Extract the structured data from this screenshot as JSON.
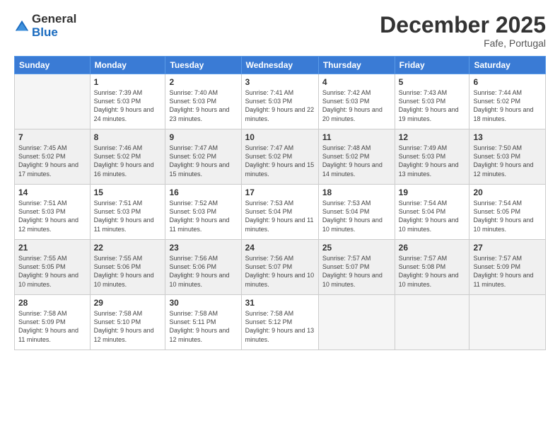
{
  "logo": {
    "general": "General",
    "blue": "Blue"
  },
  "title": "December 2025",
  "location": "Fafe, Portugal",
  "weekdays": [
    "Sunday",
    "Monday",
    "Tuesday",
    "Wednesday",
    "Thursday",
    "Friday",
    "Saturday"
  ],
  "weeks": [
    [
      {
        "day": "",
        "sunrise": "",
        "sunset": "",
        "daylight": ""
      },
      {
        "day": "1",
        "sunrise": "Sunrise: 7:39 AM",
        "sunset": "Sunset: 5:03 PM",
        "daylight": "Daylight: 9 hours and 24 minutes."
      },
      {
        "day": "2",
        "sunrise": "Sunrise: 7:40 AM",
        "sunset": "Sunset: 5:03 PM",
        "daylight": "Daylight: 9 hours and 23 minutes."
      },
      {
        "day": "3",
        "sunrise": "Sunrise: 7:41 AM",
        "sunset": "Sunset: 5:03 PM",
        "daylight": "Daylight: 9 hours and 22 minutes."
      },
      {
        "day": "4",
        "sunrise": "Sunrise: 7:42 AM",
        "sunset": "Sunset: 5:03 PM",
        "daylight": "Daylight: 9 hours and 20 minutes."
      },
      {
        "day": "5",
        "sunrise": "Sunrise: 7:43 AM",
        "sunset": "Sunset: 5:03 PM",
        "daylight": "Daylight: 9 hours and 19 minutes."
      },
      {
        "day": "6",
        "sunrise": "Sunrise: 7:44 AM",
        "sunset": "Sunset: 5:02 PM",
        "daylight": "Daylight: 9 hours and 18 minutes."
      }
    ],
    [
      {
        "day": "7",
        "sunrise": "Sunrise: 7:45 AM",
        "sunset": "Sunset: 5:02 PM",
        "daylight": "Daylight: 9 hours and 17 minutes."
      },
      {
        "day": "8",
        "sunrise": "Sunrise: 7:46 AM",
        "sunset": "Sunset: 5:02 PM",
        "daylight": "Daylight: 9 hours and 16 minutes."
      },
      {
        "day": "9",
        "sunrise": "Sunrise: 7:47 AM",
        "sunset": "Sunset: 5:02 PM",
        "daylight": "Daylight: 9 hours and 15 minutes."
      },
      {
        "day": "10",
        "sunrise": "Sunrise: 7:47 AM",
        "sunset": "Sunset: 5:02 PM",
        "daylight": "Daylight: 9 hours and 15 minutes."
      },
      {
        "day": "11",
        "sunrise": "Sunrise: 7:48 AM",
        "sunset": "Sunset: 5:02 PM",
        "daylight": "Daylight: 9 hours and 14 minutes."
      },
      {
        "day": "12",
        "sunrise": "Sunrise: 7:49 AM",
        "sunset": "Sunset: 5:03 PM",
        "daylight": "Daylight: 9 hours and 13 minutes."
      },
      {
        "day": "13",
        "sunrise": "Sunrise: 7:50 AM",
        "sunset": "Sunset: 5:03 PM",
        "daylight": "Daylight: 9 hours and 12 minutes."
      }
    ],
    [
      {
        "day": "14",
        "sunrise": "Sunrise: 7:51 AM",
        "sunset": "Sunset: 5:03 PM",
        "daylight": "Daylight: 9 hours and 12 minutes."
      },
      {
        "day": "15",
        "sunrise": "Sunrise: 7:51 AM",
        "sunset": "Sunset: 5:03 PM",
        "daylight": "Daylight: 9 hours and 11 minutes."
      },
      {
        "day": "16",
        "sunrise": "Sunrise: 7:52 AM",
        "sunset": "Sunset: 5:03 PM",
        "daylight": "Daylight: 9 hours and 11 minutes."
      },
      {
        "day": "17",
        "sunrise": "Sunrise: 7:53 AM",
        "sunset": "Sunset: 5:04 PM",
        "daylight": "Daylight: 9 hours and 11 minutes."
      },
      {
        "day": "18",
        "sunrise": "Sunrise: 7:53 AM",
        "sunset": "Sunset: 5:04 PM",
        "daylight": "Daylight: 9 hours and 10 minutes."
      },
      {
        "day": "19",
        "sunrise": "Sunrise: 7:54 AM",
        "sunset": "Sunset: 5:04 PM",
        "daylight": "Daylight: 9 hours and 10 minutes."
      },
      {
        "day": "20",
        "sunrise": "Sunrise: 7:54 AM",
        "sunset": "Sunset: 5:05 PM",
        "daylight": "Daylight: 9 hours and 10 minutes."
      }
    ],
    [
      {
        "day": "21",
        "sunrise": "Sunrise: 7:55 AM",
        "sunset": "Sunset: 5:05 PM",
        "daylight": "Daylight: 9 hours and 10 minutes."
      },
      {
        "day": "22",
        "sunrise": "Sunrise: 7:55 AM",
        "sunset": "Sunset: 5:06 PM",
        "daylight": "Daylight: 9 hours and 10 minutes."
      },
      {
        "day": "23",
        "sunrise": "Sunrise: 7:56 AM",
        "sunset": "Sunset: 5:06 PM",
        "daylight": "Daylight: 9 hours and 10 minutes."
      },
      {
        "day": "24",
        "sunrise": "Sunrise: 7:56 AM",
        "sunset": "Sunset: 5:07 PM",
        "daylight": "Daylight: 9 hours and 10 minutes."
      },
      {
        "day": "25",
        "sunrise": "Sunrise: 7:57 AM",
        "sunset": "Sunset: 5:07 PM",
        "daylight": "Daylight: 9 hours and 10 minutes."
      },
      {
        "day": "26",
        "sunrise": "Sunrise: 7:57 AM",
        "sunset": "Sunset: 5:08 PM",
        "daylight": "Daylight: 9 hours and 10 minutes."
      },
      {
        "day": "27",
        "sunrise": "Sunrise: 7:57 AM",
        "sunset": "Sunset: 5:09 PM",
        "daylight": "Daylight: 9 hours and 11 minutes."
      }
    ],
    [
      {
        "day": "28",
        "sunrise": "Sunrise: 7:58 AM",
        "sunset": "Sunset: 5:09 PM",
        "daylight": "Daylight: 9 hours and 11 minutes."
      },
      {
        "day": "29",
        "sunrise": "Sunrise: 7:58 AM",
        "sunset": "Sunset: 5:10 PM",
        "daylight": "Daylight: 9 hours and 12 minutes."
      },
      {
        "day": "30",
        "sunrise": "Sunrise: 7:58 AM",
        "sunset": "Sunset: 5:11 PM",
        "daylight": "Daylight: 9 hours and 12 minutes."
      },
      {
        "day": "31",
        "sunrise": "Sunrise: 7:58 AM",
        "sunset": "Sunset: 5:12 PM",
        "daylight": "Daylight: 9 hours and 13 minutes."
      },
      {
        "day": "",
        "sunrise": "",
        "sunset": "",
        "daylight": ""
      },
      {
        "day": "",
        "sunrise": "",
        "sunset": "",
        "daylight": ""
      },
      {
        "day": "",
        "sunrise": "",
        "sunset": "",
        "daylight": ""
      }
    ]
  ]
}
